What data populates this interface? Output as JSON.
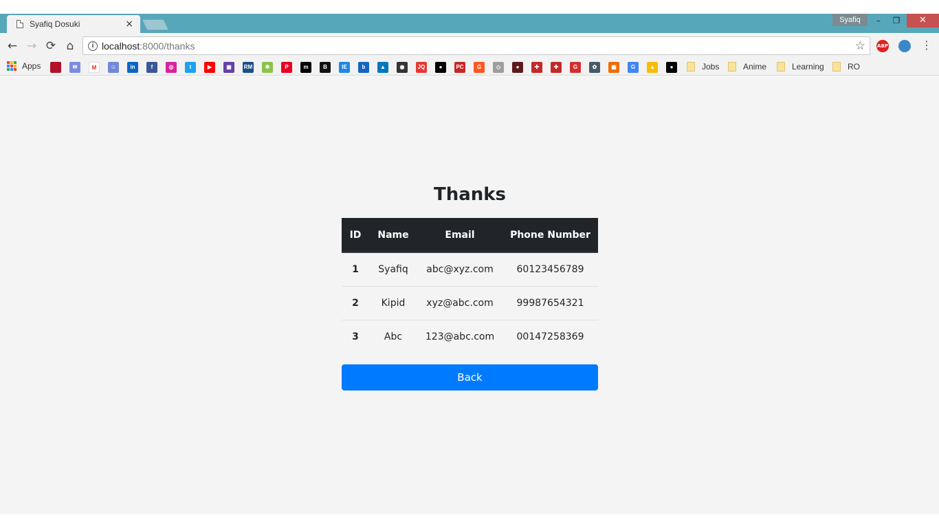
{
  "browser": {
    "tab_title": "Syafiq Dosuki",
    "tab_close": "×",
    "profile_name": "Syafiq",
    "window_controls": {
      "minimize": "–",
      "restore": "❐",
      "close": "✕"
    },
    "nav": {
      "back": "←",
      "forward": "→",
      "reload": "⟳",
      "home": "⌂"
    },
    "url_host": "localhost",
    "url_path": ":8000/thanks",
    "info_glyph": "i",
    "star": "☆",
    "menu": "⋮",
    "ext_abp": "ABP"
  },
  "bookmarks": {
    "apps_label": "Apps",
    "icons": [
      {
        "name": "bookmark-icon-red-doc",
        "color": "#b3102a",
        "glyph": ""
      },
      {
        "name": "mail-icon",
        "color": "#7b8ce0",
        "glyph": "✉"
      },
      {
        "name": "gmail-icon",
        "color": "#ffffff",
        "glyph": "M"
      },
      {
        "name": "discord-icon",
        "color": "#7289da",
        "glyph": "☺"
      },
      {
        "name": "linkedin-icon",
        "color": "#0a66c2",
        "glyph": "in"
      },
      {
        "name": "facebook-icon",
        "color": "#3b5998",
        "glyph": "f"
      },
      {
        "name": "instagram-icon",
        "color": "#d6249f",
        "glyph": "◎"
      },
      {
        "name": "twitter-icon",
        "color": "#1da1f2",
        "glyph": "t"
      },
      {
        "name": "youtube-icon",
        "color": "#ff0000",
        "glyph": "▶"
      },
      {
        "name": "twitch-icon",
        "color": "#6441a5",
        "glyph": "▣"
      },
      {
        "name": "rm-icon",
        "color": "#1d4e89",
        "glyph": "RM"
      },
      {
        "name": "bookmark-icon-green",
        "color": "#8bc34a",
        "glyph": "✱"
      },
      {
        "name": "pinterest-icon",
        "color": "#e60023",
        "glyph": "P"
      },
      {
        "name": "medium-icon",
        "color": "#000000",
        "glyph": "m"
      },
      {
        "name": "bookmark-icon-b",
        "color": "#111111",
        "glyph": "B"
      },
      {
        "name": "bookmark-icon-ie",
        "color": "#1e88e5",
        "glyph": "IE"
      },
      {
        "name": "bookmark-icon-blue-b",
        "color": "#1565c0",
        "glyph": "b"
      },
      {
        "name": "bookmark-icon-mountain",
        "color": "#0277bd",
        "glyph": "▲"
      },
      {
        "name": "bookmark-icon-chat",
        "color": "#333333",
        "glyph": "◉"
      },
      {
        "name": "bookmark-icon-jq",
        "color": "#e53935",
        "glyph": "JQ"
      },
      {
        "name": "bookmark-icon-egg",
        "color": "#000000",
        "glyph": "●"
      },
      {
        "name": "pcgamer-icon",
        "color": "#c62828",
        "glyph": "PC"
      },
      {
        "name": "bookmark-icon-g-circle",
        "color": "#ff5722",
        "glyph": "G"
      },
      {
        "name": "bookmark-icon-diamond",
        "color": "#9e9e9e",
        "glyph": "◇"
      },
      {
        "name": "bookmark-icon-avatar",
        "color": "#5d1a1a",
        "glyph": "●"
      },
      {
        "name": "gamepad-icon-1",
        "color": "#c62828",
        "glyph": "✚"
      },
      {
        "name": "gamepad-icon-2",
        "color": "#c62828",
        "glyph": "✚"
      },
      {
        "name": "bookmark-icon-g-red",
        "color": "#d32f2f",
        "glyph": "G"
      },
      {
        "name": "bookmark-icon-gear",
        "color": "#455a64",
        "glyph": "✿"
      },
      {
        "name": "bookmark-icon-orange-grid",
        "color": "#ef6c00",
        "glyph": "▦"
      },
      {
        "name": "google-translate-icon",
        "color": "#4285f4",
        "glyph": "G"
      },
      {
        "name": "google-drive-icon",
        "color": "#fbbc05",
        "glyph": "▲"
      },
      {
        "name": "github-icon",
        "color": "#000000",
        "glyph": "●"
      }
    ],
    "folders": [
      "Jobs",
      "Anime",
      "Learning",
      "RO"
    ]
  },
  "page": {
    "heading": "Thanks",
    "table": {
      "columns": [
        "ID",
        "Name",
        "Email",
        "Phone Number"
      ],
      "rows": [
        {
          "id": "1",
          "name": "Syafiq",
          "email": "abc@xyz.com",
          "phone": "60123456789"
        },
        {
          "id": "2",
          "name": "Kipid",
          "email": "xyz@abc.com",
          "phone": "99987654321"
        },
        {
          "id": "3",
          "name": "Abc",
          "email": "123@abc.com",
          "phone": "00147258369"
        }
      ]
    },
    "back_label": "Back"
  },
  "colors": {
    "tabstrip": "#57a7bb",
    "table_header": "#212529",
    "primary_button": "#007bff",
    "page_bg": "#f4f4f4"
  }
}
